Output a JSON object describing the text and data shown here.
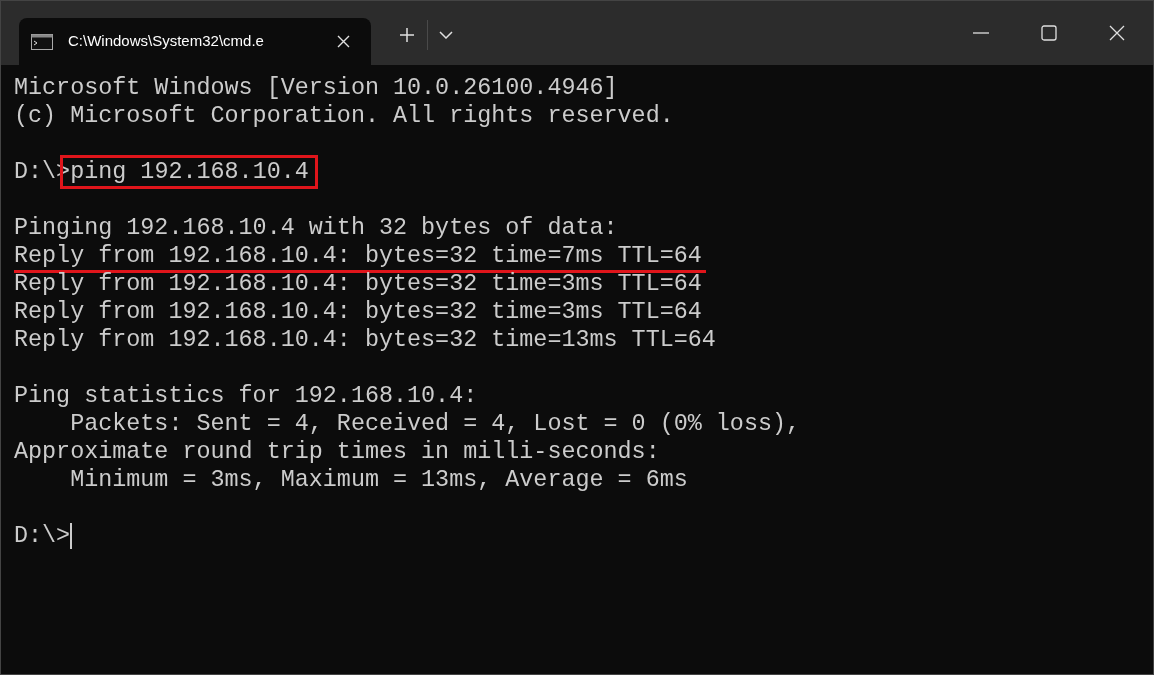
{
  "tabs": [
    {
      "title": "C:\\Windows\\System32\\cmd.e",
      "selected": true
    }
  ],
  "console": {
    "lines": [
      {
        "kind": "text",
        "text": "Microsoft Windows [Version 10.0.26100.4946]"
      },
      {
        "kind": "text",
        "text": "(c) Microsoft Corporation. All rights reserved."
      },
      {
        "kind": "blank"
      },
      {
        "kind": "command",
        "prompt": "D:\\>",
        "command": "ping 192.168.10.4",
        "boxed": true
      },
      {
        "kind": "blank"
      },
      {
        "kind": "text",
        "text": "Pinging 192.168.10.4 with 32 bytes of data:"
      },
      {
        "kind": "text",
        "text": "Reply from 192.168.10.4: bytes=32 time=7ms TTL=64",
        "underlined": true
      },
      {
        "kind": "text",
        "text": "Reply from 192.168.10.4: bytes=32 time=3ms TTL=64"
      },
      {
        "kind": "text",
        "text": "Reply from 192.168.10.4: bytes=32 time=3ms TTL=64"
      },
      {
        "kind": "text",
        "text": "Reply from 192.168.10.4: bytes=32 time=13ms TTL=64"
      },
      {
        "kind": "blank"
      },
      {
        "kind": "text",
        "text": "Ping statistics for 192.168.10.4:"
      },
      {
        "kind": "text",
        "text": "    Packets: Sent = 4, Received = 4, Lost = 0 (0% loss),"
      },
      {
        "kind": "text",
        "text": "Approximate round trip times in milli-seconds:"
      },
      {
        "kind": "text",
        "text": "    Minimum = 3ms, Maximum = 13ms, Average = 6ms"
      },
      {
        "kind": "blank"
      },
      {
        "kind": "command",
        "prompt": "D:\\>",
        "cursor": true
      }
    ]
  }
}
